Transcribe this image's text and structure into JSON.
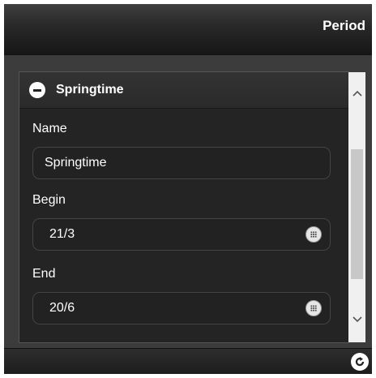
{
  "header": {
    "title": "Period"
  },
  "panel": {
    "title": "Springtime",
    "collapse_icon": "minus-circle-icon"
  },
  "form": {
    "name_label": "Name",
    "name_value": "Springtime",
    "begin_label": "Begin",
    "begin_value": "21/3",
    "end_label": "End",
    "end_value": "20/6",
    "picker_icon": "grid-dots-icon"
  },
  "footer": {
    "refresh_icon": "refresh-icon"
  }
}
